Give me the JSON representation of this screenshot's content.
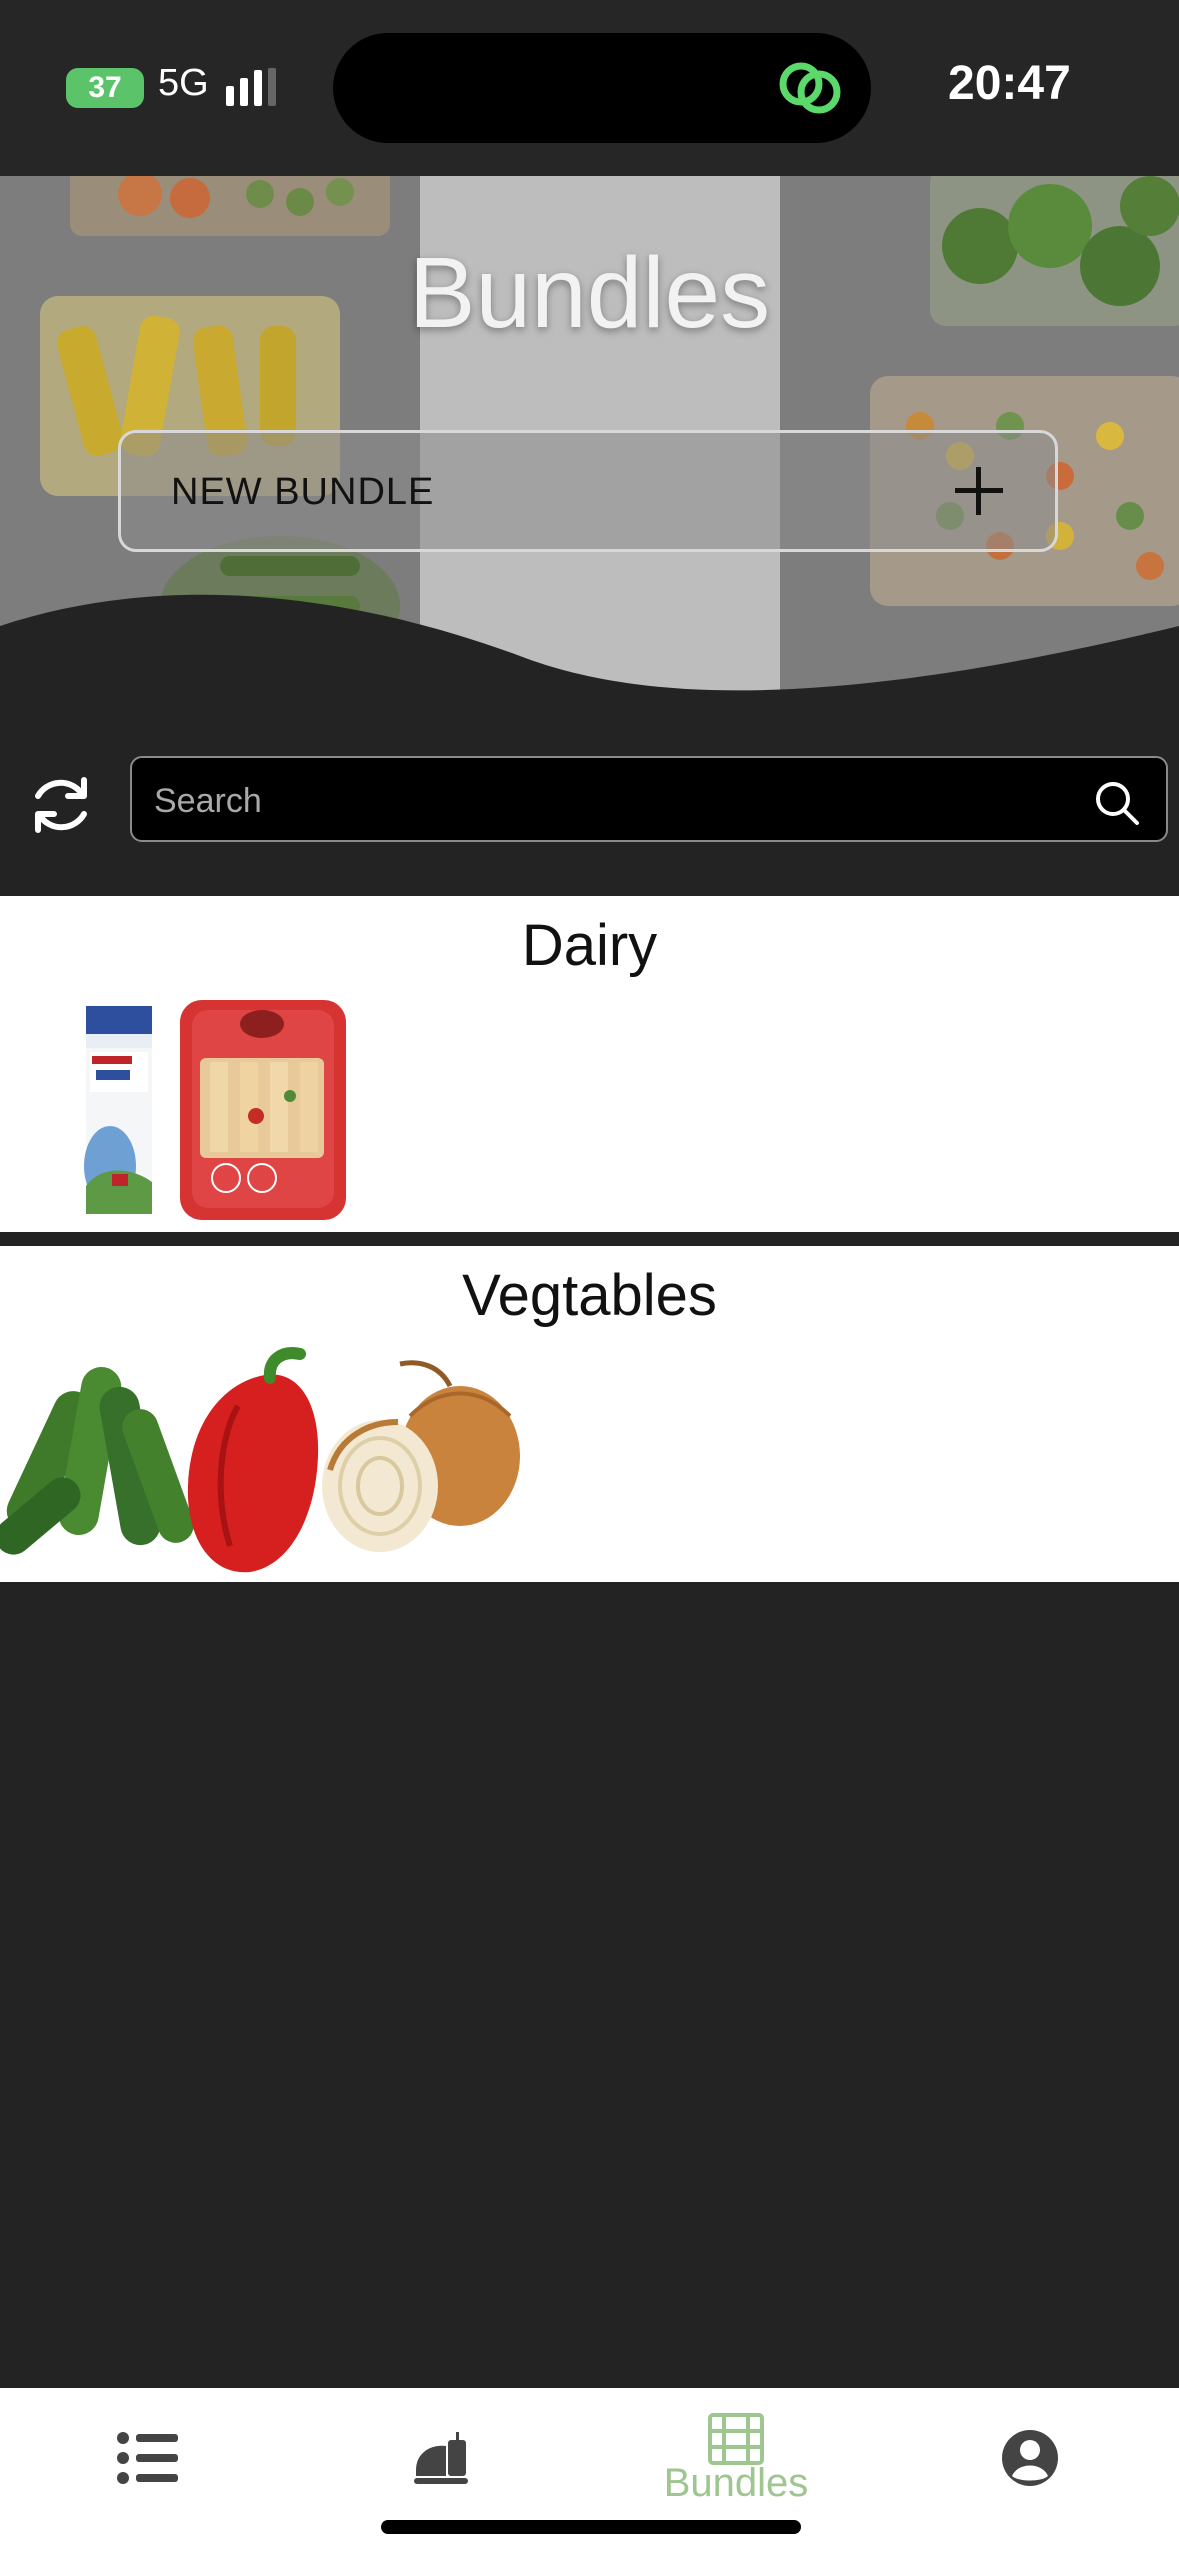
{
  "status_bar": {
    "battery": "37",
    "network": "5G",
    "time": "20:47"
  },
  "header": {
    "title": "Bundles",
    "new_bundle_label": "NEW BUNDLE"
  },
  "search": {
    "placeholder": "Search"
  },
  "bundles": [
    {
      "title": "Dairy",
      "items": [
        "milk-carton",
        "pasta-tray"
      ]
    },
    {
      "title": "Vegtables",
      "items": [
        "cucumbers",
        "red-pepper",
        "onion"
      ]
    }
  ],
  "tab_bar": {
    "tabs": [
      {
        "icon": "list-icon",
        "label": ""
      },
      {
        "icon": "food-icon",
        "label": ""
      },
      {
        "icon": "bundles-icon",
        "label": "Bundles",
        "active": true
      },
      {
        "icon": "profile-icon",
        "label": ""
      }
    ]
  },
  "colors": {
    "accent": "#9fc590",
    "background": "#232323",
    "status_green": "#5bc46a"
  }
}
